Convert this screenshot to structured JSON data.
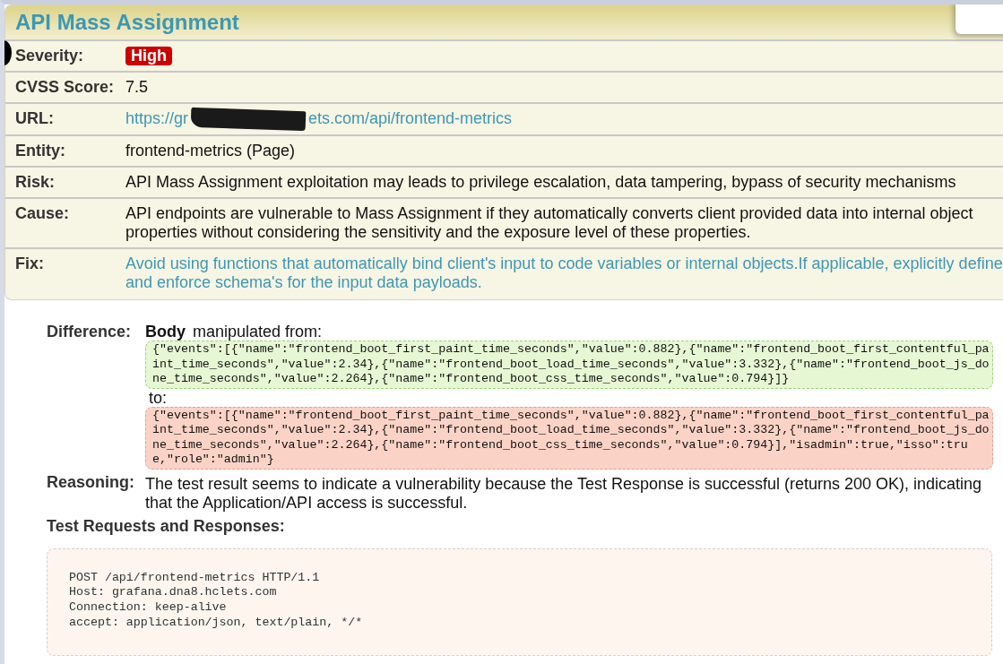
{
  "finding": {
    "title": "API Mass Assignment",
    "fields": [
      {
        "kind": "badge",
        "label": "Severity:",
        "value": "High",
        "color": "#cc0000"
      },
      {
        "kind": "text",
        "label": "CVSS Score:",
        "value": "7.5"
      },
      {
        "kind": "link",
        "label": "URL:",
        "parts": [
          "https://gr",
          "ets.com/api/frontend-metrics"
        ],
        "redacted": true
      },
      {
        "kind": "text",
        "label": "Entity:",
        "value": "frontend-metrics (Page)"
      },
      {
        "kind": "text",
        "label": "Risk:",
        "value": "API Mass Assignment exploitation may leads to privilege escalation, data tampering, bypass of security mechanisms"
      },
      {
        "kind": "text",
        "label": "Cause:",
        "value": "API endpoints are vulnerable to Mass Assignment if they automatically converts client provided data into internal object properties without considering the sensitivity and the exposure level of these properties."
      },
      {
        "kind": "link",
        "label": "Fix:",
        "value": "Avoid using functions that automatically bind client's input to code variables or internal objects.If applicable, explicitly define and enforce schema's for the input data payloads."
      }
    ]
  },
  "difference": {
    "label": "Difference:",
    "part": "Body",
    "from_label": "manipulated from:",
    "from": "{\"events\":[{\"name\":\"frontend_boot_first_paint_time_seconds\",\"value\":0.882},{\"name\":\"frontend_boot_first_contentful_paint_time_seconds\",\"value\":2.34},{\"name\":\"frontend_boot_load_time_seconds\",\"value\":3.332},{\"name\":\"frontend_boot_js_done_time_seconds\",\"value\":2.264},{\"name\":\"frontend_boot_css_time_seconds\",\"value\":0.794}]}",
    "to_label": "to:",
    "to": "{\"events\":[{\"name\":\"frontend_boot_first_paint_time_seconds\",\"value\":0.882},{\"name\":\"frontend_boot_first_contentful_paint_time_seconds\",\"value\":2.34},{\"name\":\"frontend_boot_load_time_seconds\",\"value\":3.332},{\"name\":\"frontend_boot_js_done_time_seconds\",\"value\":2.264},{\"name\":\"frontend_boot_css_time_seconds\",\"value\":0.794}],\"isadmin\":true,\"isso\":true,\"role\":\"admin\"}"
  },
  "reasoning": {
    "label": "Reasoning:",
    "text": "The test result seems to indicate a vulnerability because the Test Response is successful (returns 200 OK), indicating that the Application/API access is successful."
  },
  "requests": {
    "title": "Test Requests and Responses:",
    "lines": [
      "POST /api/frontend-metrics HTTP/1.1",
      "Host: grafana.dna8.hclets.com",
      "Connection: keep-alive",
      "accept: application/json, text/plain, */*"
    ]
  }
}
